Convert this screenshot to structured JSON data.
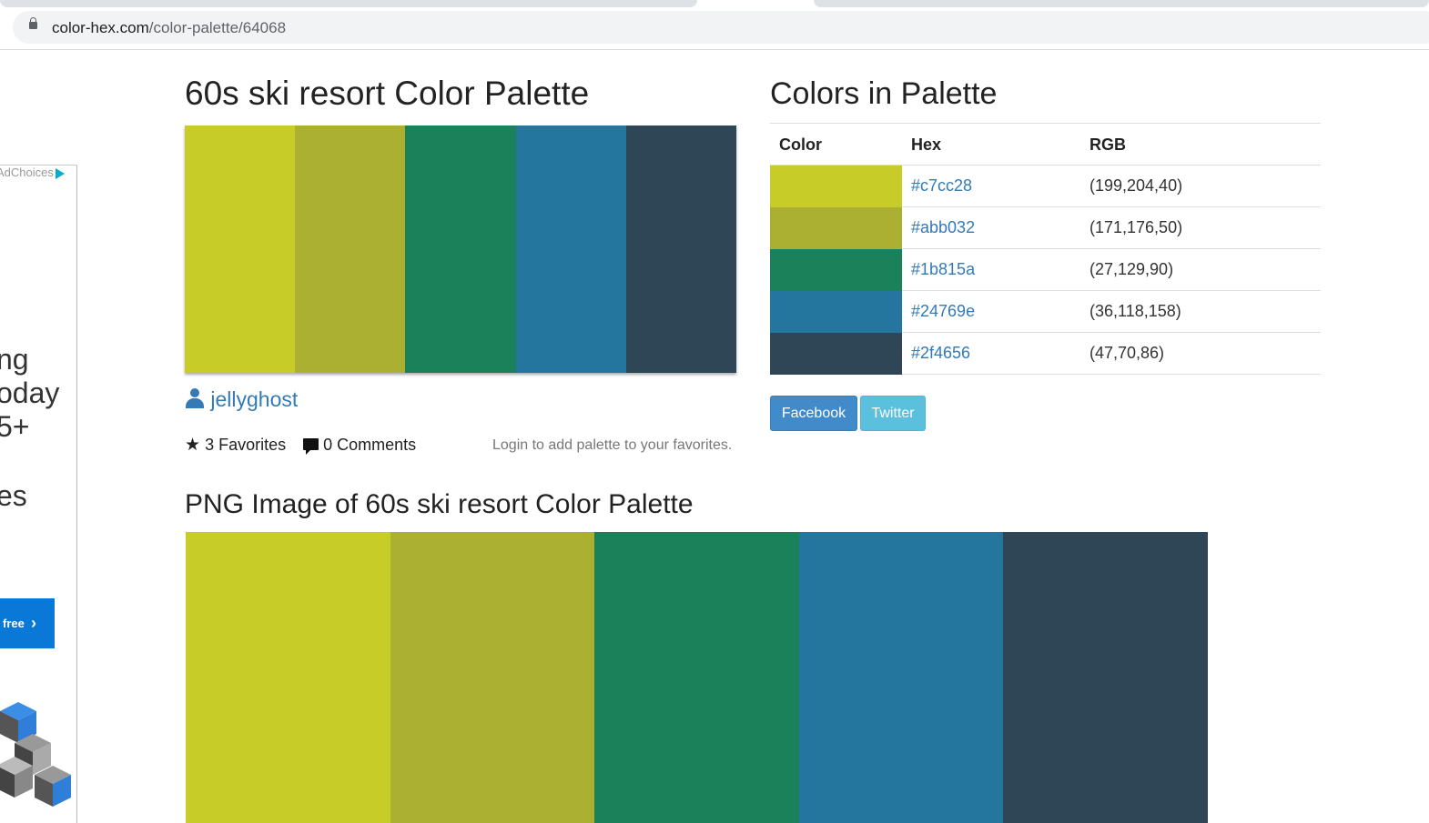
{
  "browser": {
    "url_domain": "color-hex.com",
    "url_path": "/color-palette/64068"
  },
  "ad": {
    "adchoices": "AdChoices",
    "lines": [
      "ng",
      "oday",
      "5+"
    ],
    "line_extra": "es",
    "button_label": "free"
  },
  "page": {
    "title": "60s ski resort Color Palette",
    "author": "jellyghost",
    "favorites": "3 Favorites",
    "comments": "0 Comments",
    "login_note": "Login to add palette to your favorites."
  },
  "colors_section": {
    "title": "Colors in Palette",
    "headers": {
      "color": "Color",
      "hex": "Hex",
      "rgb": "RGB"
    },
    "rows": [
      {
        "hex": "#c7cc28",
        "rgb": "(199,204,40)"
      },
      {
        "hex": "#abb032",
        "rgb": "(171,176,50)"
      },
      {
        "hex": "#1b815a",
        "rgb": "(27,129,90)"
      },
      {
        "hex": "#24769e",
        "rgb": "(36,118,158)"
      },
      {
        "hex": "#2f4656",
        "rgb": "(47,70,86)"
      }
    ]
  },
  "share": {
    "facebook": "Facebook",
    "twitter": "Twitter"
  },
  "png_section": {
    "title": "PNG Image of 60s ski resort Color Palette"
  },
  "palette_colors": [
    "#c7cc28",
    "#abb032",
    "#1b815a",
    "#24769e",
    "#2f4656"
  ]
}
